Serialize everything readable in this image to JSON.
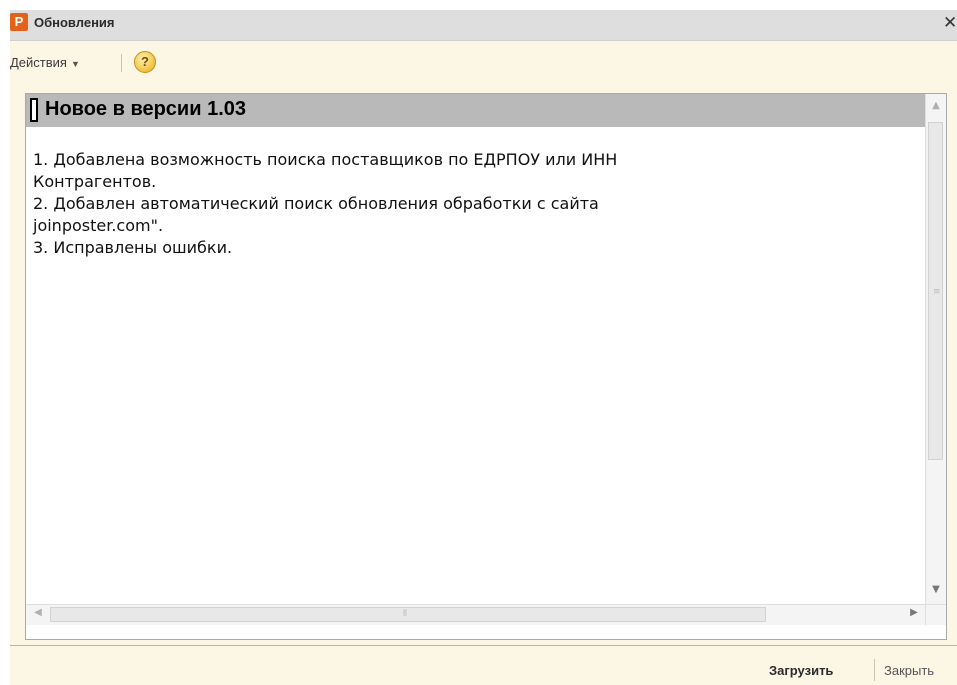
{
  "window": {
    "title": "Обновления",
    "app_icon_letter": "P",
    "close_glyph": "✕"
  },
  "toolbar": {
    "actions_label": "Действия",
    "help_glyph": "?"
  },
  "document": {
    "heading": "Новое в версии 1.03",
    "lines": [
      "1. Добавлена возможность поиска поставщиков по ЕДРПОУ или ИНН",
      "Контрагентов.",
      "2. Добавлен автоматический поиск обновления обработки с сайта",
      "joinposter.com\".",
      "3. Исправлены ошибки."
    ]
  },
  "footer": {
    "load_label": "Загрузить",
    "close_label": "Закрыть"
  },
  "colors": {
    "app_icon": "#e2621b",
    "heading_band": "#b9b9b9",
    "panel_background": "#fbf7e4"
  }
}
